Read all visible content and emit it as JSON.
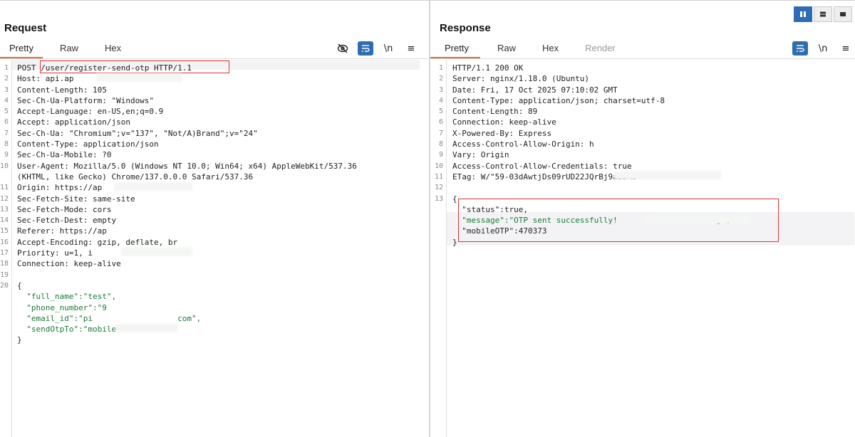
{
  "request": {
    "title": "Request",
    "tabs": [
      "Pretty",
      "Raw",
      "Hex"
    ],
    "lines": [
      {
        "n": "1",
        "t": "POST /user/register-send-otp HTTP/1.1"
      },
      {
        "n": "2",
        "t": "Host: api.ap"
      },
      {
        "n": "3",
        "t": "Content-Length: 105"
      },
      {
        "n": "4",
        "t": "Sec-Ch-Ua-Platform: \"Windows\""
      },
      {
        "n": "5",
        "t": "Accept-Language: en-US,en;q=0.9"
      },
      {
        "n": "6",
        "t": "Accept: application/json"
      },
      {
        "n": "7",
        "t": "Sec-Ch-Ua: \"Chromium\";v=\"137\", \"Not/A)Brand\";v=\"24\""
      },
      {
        "n": "8",
        "t": "Content-Type: application/json"
      },
      {
        "n": "9",
        "t": "Sec-Ch-Ua-Mobile: ?0"
      },
      {
        "n": "10",
        "t": "User-Agent: Mozilla/5.0 (Windows NT 10.0; Win64; x64) AppleWebKit/537.36"
      },
      {
        "n": "",
        "t": "(KHTML, like Gecko) Chrome/137.0.0.0 Safari/537.36"
      },
      {
        "n": "11",
        "t": "Origin: https://ap"
      },
      {
        "n": "12",
        "t": "Sec-Fetch-Site: same-site"
      },
      {
        "n": "13",
        "t": "Sec-Fetch-Mode: cors"
      },
      {
        "n": "14",
        "t": "Sec-Fetch-Dest: empty"
      },
      {
        "n": "15",
        "t": "Referer: https://ap"
      },
      {
        "n": "16",
        "t": "Accept-Encoding: gzip, deflate, br"
      },
      {
        "n": "17",
        "t": "Priority: u=1, i"
      },
      {
        "n": "18",
        "t": "Connection: keep-alive"
      },
      {
        "n": "19",
        "t": ""
      },
      {
        "n": "20",
        "t": "{"
      },
      {
        "n": "",
        "t": "  \"full_name\":\"test\","
      },
      {
        "n": "",
        "t": "  \"phone_number\":\"9"
      },
      {
        "n": "",
        "t": "  \"email_id\":\"pi                  com\","
      },
      {
        "n": "",
        "t": "  \"sendOtpTo\":\"mobile\""
      },
      {
        "n": "",
        "t": "}"
      }
    ]
  },
  "response": {
    "title": "Response",
    "tabs": [
      "Pretty",
      "Raw",
      "Hex",
      "Render"
    ],
    "lines": [
      {
        "n": "1",
        "t": "HTTP/1.1 200 OK"
      },
      {
        "n": "2",
        "t": "Server: nginx/1.18.0 (Ubuntu)"
      },
      {
        "n": "3",
        "t": "Date: Fri, 17 Oct 2025 07:10:02 GMT"
      },
      {
        "n": "4",
        "t": "Content-Type: application/json; charset=utf-8"
      },
      {
        "n": "5",
        "t": "Content-Length: 89"
      },
      {
        "n": "6",
        "t": "Connection: keep-alive"
      },
      {
        "n": "7",
        "t": "X-Powered-By: Express"
      },
      {
        "n": "8",
        "t": "Access-Control-Allow-Origin: h"
      },
      {
        "n": "9",
        "t": "Vary: Origin"
      },
      {
        "n": "10",
        "t": "Access-Control-Allow-Credentials: true"
      },
      {
        "n": "11",
        "t": "ETag: W/\"59-03dAwtjDs09rUD22JQrBj9aB3As\""
      },
      {
        "n": "12",
        "t": ""
      },
      {
        "n": "13",
        "t": "{"
      },
      {
        "n": "",
        "t": "  \"status\":true,"
      },
      {
        "n": "",
        "t": "  \"message\":\"OTP sent successfully!                     }\","
      },
      {
        "n": "",
        "t": "  \"mobileOTP\":470373"
      },
      {
        "n": "",
        "t": "}"
      }
    ]
  },
  "toolbar": {
    "newline_label": "\\n",
    "menu_label": "≡"
  },
  "colors": {
    "accent": "#2e6db4",
    "tab_underline": "#e2683c",
    "highlight_box": "#dd3333"
  }
}
